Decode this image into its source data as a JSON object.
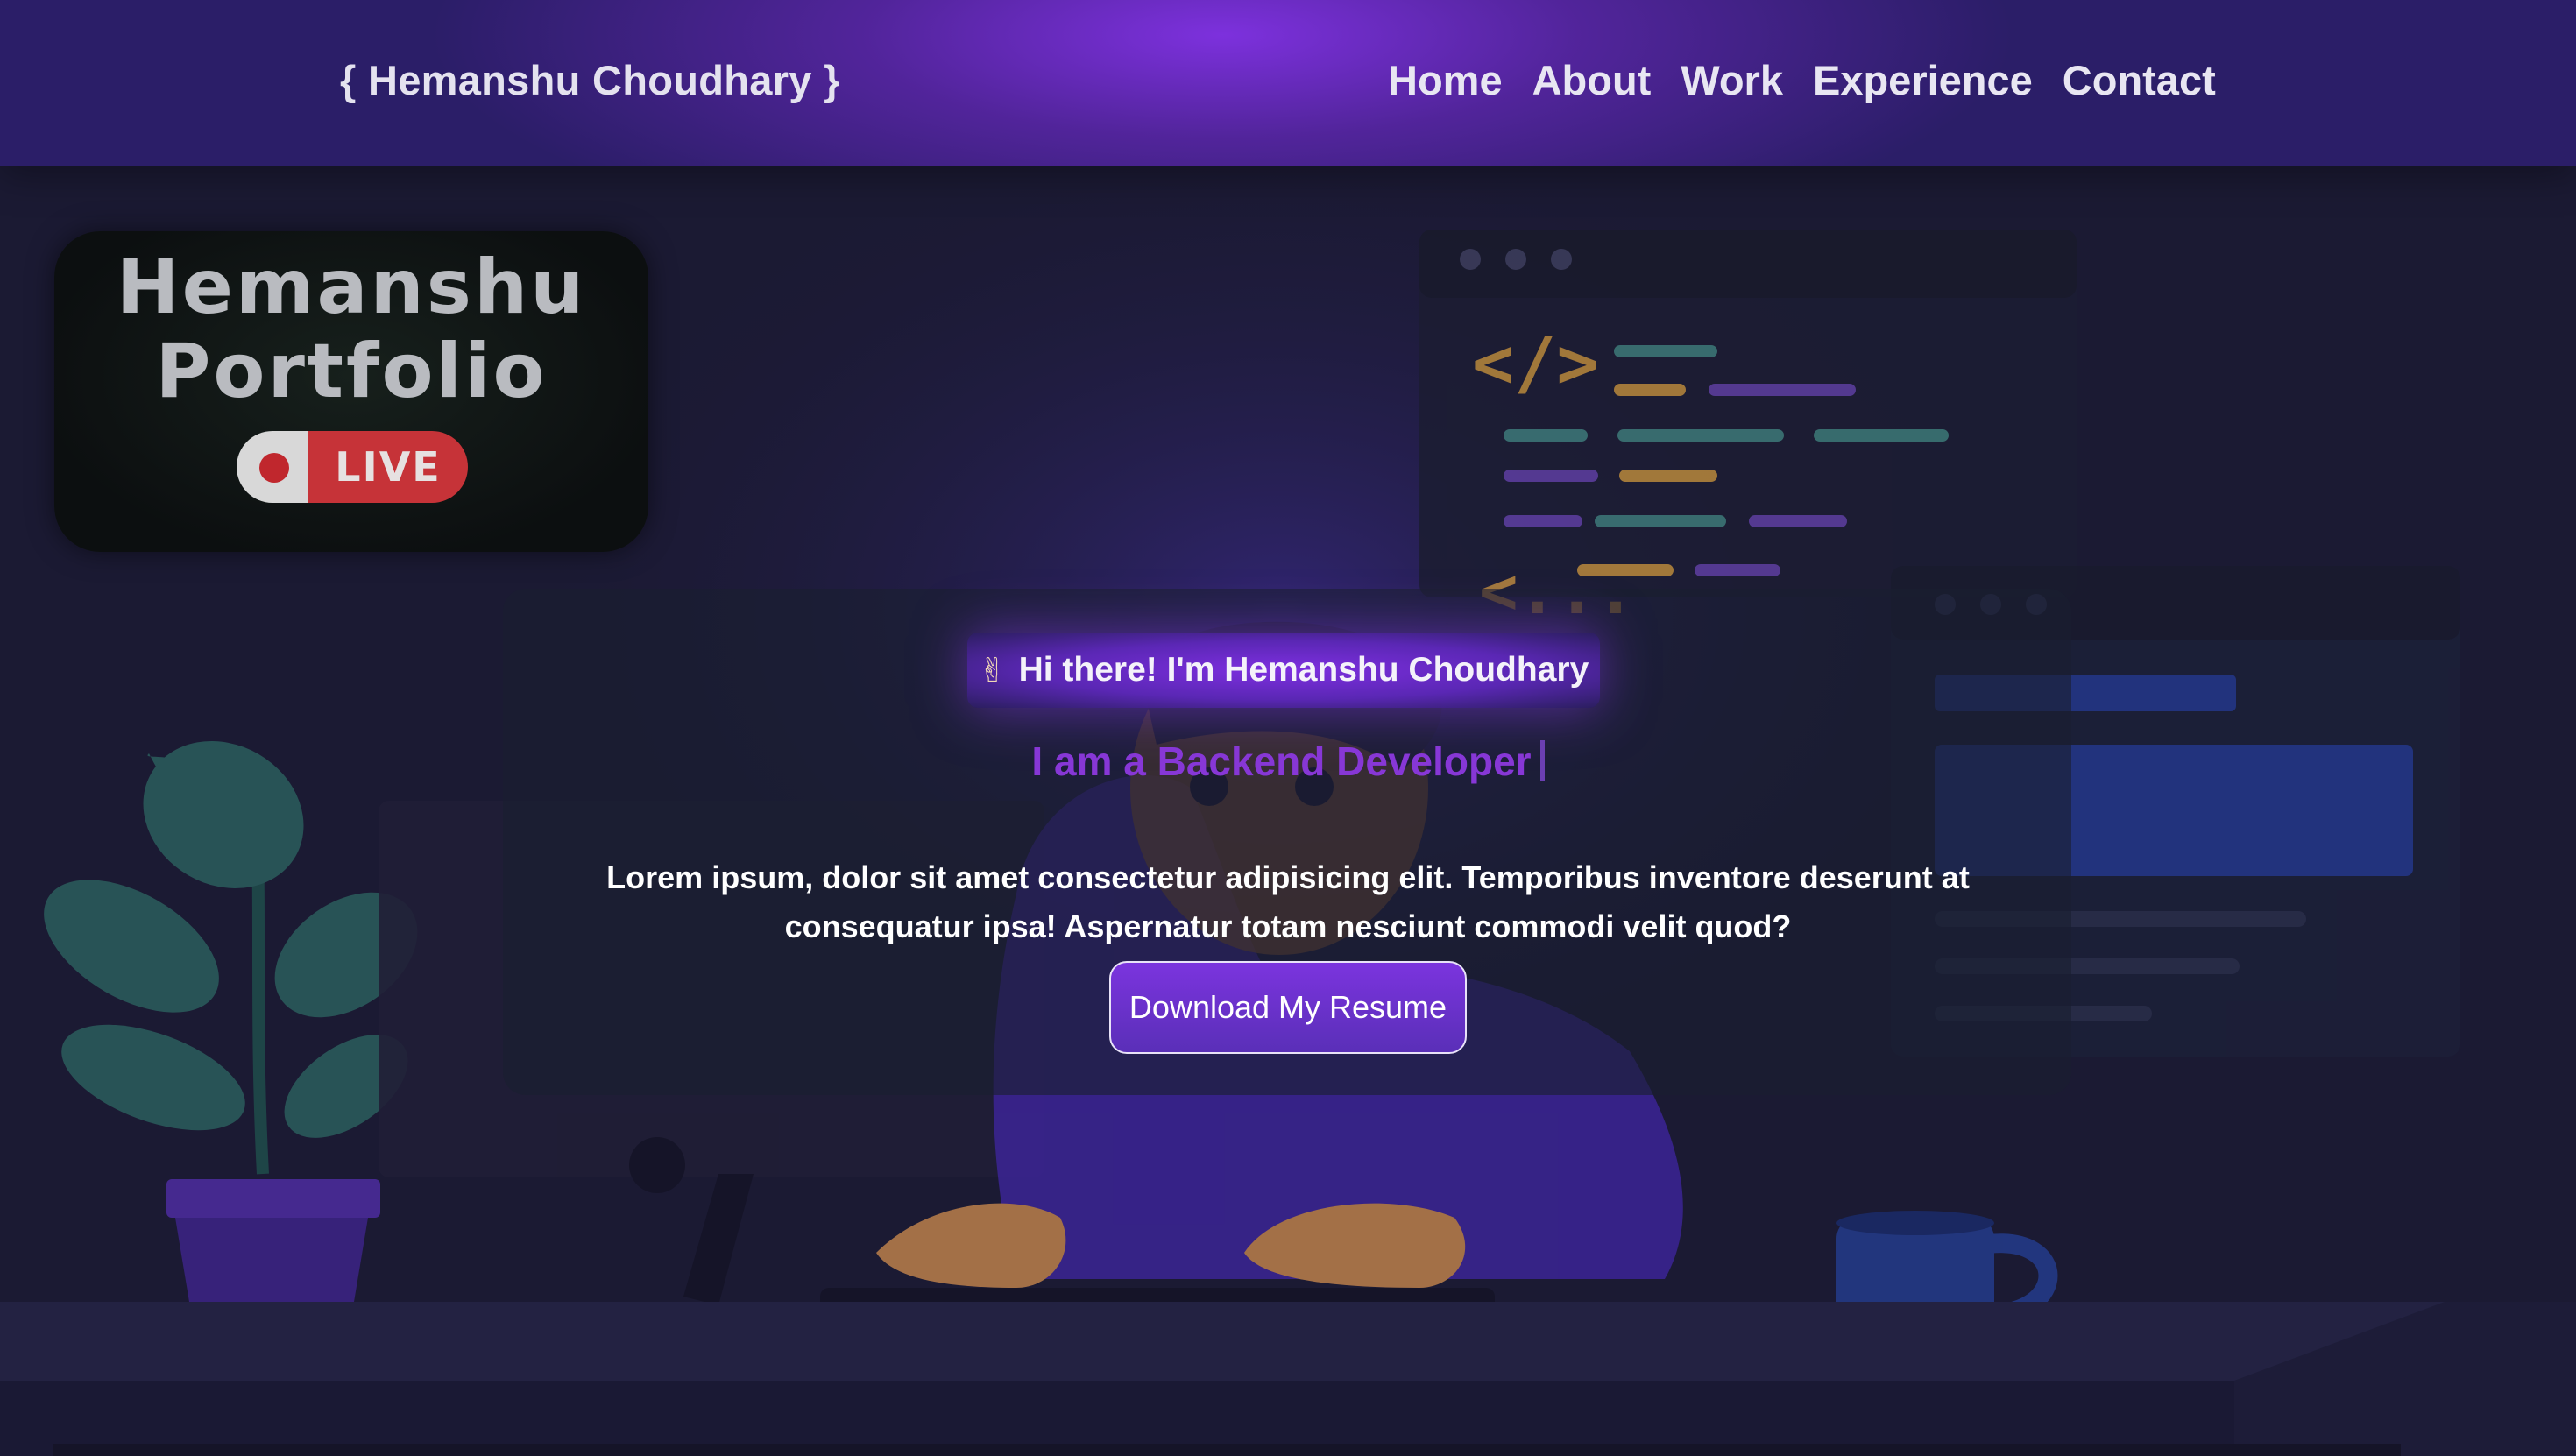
{
  "header": {
    "brand": "{ Hemanshu Choudhary }",
    "nav": [
      {
        "label": "Home"
      },
      {
        "label": "About"
      },
      {
        "label": "Work"
      },
      {
        "label": "Experience"
      },
      {
        "label": "Contact"
      }
    ]
  },
  "logo": {
    "line1": "Hemanshu",
    "line2": "Portfolio",
    "badge": "LIVE"
  },
  "hero": {
    "greeting_emoji": "✌",
    "greeting": "Hi there! I'm Hemanshu Choudhary",
    "role": "I am a Backend Developer",
    "description": "Lorem ipsum, dolor sit amet consectetur adipisicing elit. Temporibus inventore deserunt at consequatur ipsa! Aspernatur totam nesciunt commodi velit quod?",
    "cta": "Download My Resume"
  },
  "background": {
    "code_open": "</>",
    "code_close": "<..."
  },
  "colors": {
    "accent": "#8737d6",
    "nav_glow": "#7d2fe0",
    "page_bg": "#1a1830"
  }
}
